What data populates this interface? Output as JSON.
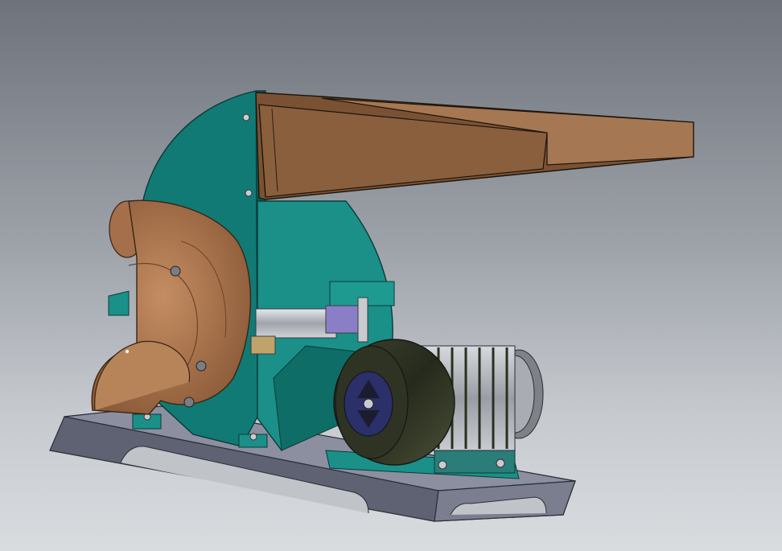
{
  "scene": {
    "subject": "hammer-mill-cad-model",
    "colors": {
      "background_top": "#6e737b",
      "background_bottom": "#d9dcdf",
      "housing": "#117a74",
      "housing_dark": "#0b5753",
      "housing_light": "#1a9088",
      "hopper": "#8a5f3e",
      "hopper_light": "#a57752",
      "cyclone": "#b27a52",
      "cyclone_dark": "#8a5a38",
      "base": "#6f7283",
      "base_top": "#8c8fa0",
      "motor_body": "#2e3324",
      "motor_fins": "#a3a7ac",
      "motor_fan_cover": "#2b2f6a",
      "shaft": "#b9bcc4",
      "coupling": "#8a7fc6"
    },
    "components": [
      "feed-hopper-icon",
      "mill-housing-icon",
      "cyclone-outlet-icon",
      "drive-shaft-icon",
      "electric-motor-icon",
      "base-frame-icon",
      "motor-mount-icon"
    ]
  }
}
